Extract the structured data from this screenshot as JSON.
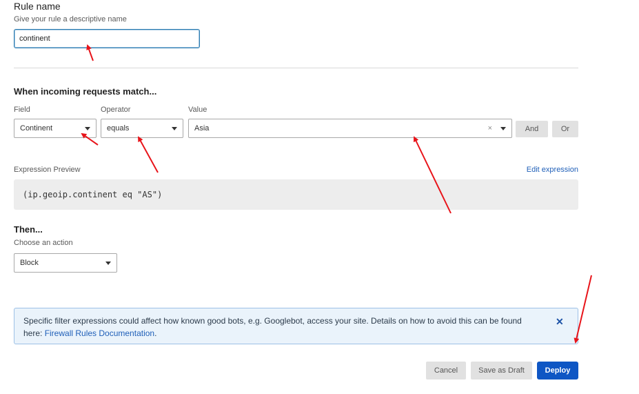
{
  "rule": {
    "title": "Rule name",
    "subtitle": "Give your rule a descriptive name",
    "value": "continent"
  },
  "match": {
    "heading": "When incoming requests match...",
    "field_label": "Field",
    "field_value": "Continent",
    "operator_label": "Operator",
    "operator_value": "equals",
    "value_label": "Value",
    "value_value": "Asia",
    "clear_glyph": "×",
    "and_label": "And",
    "or_label": "Or"
  },
  "expression": {
    "label": "Expression Preview",
    "edit_link": "Edit expression",
    "preview": "(ip.geoip.continent eq \"AS\")"
  },
  "then": {
    "heading": "Then...",
    "subtitle": "Choose an action",
    "action_value": "Block"
  },
  "alert": {
    "text": "Specific filter expressions could affect how known good bots, e.g. Googlebot, access your site. Details on how to avoid this can be found here: ",
    "link": "Firewall Rules Documentation",
    "tail": ".",
    "close_glyph": "✕"
  },
  "footer": {
    "cancel": "Cancel",
    "save_draft": "Save as Draft",
    "deploy": "Deploy"
  },
  "colors": {
    "primary": "#0e56c4",
    "link": "#1f5fb8",
    "annotation": "#e8141a",
    "alert_bg": "#eaf3fb"
  }
}
